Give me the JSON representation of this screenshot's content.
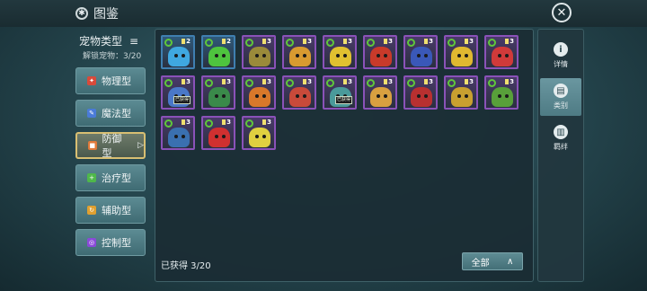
{
  "header": {
    "title": "图鉴",
    "gear_icon": "gear-icon",
    "close_icon": "close-icon"
  },
  "sidebar": {
    "heading": "宠物类型",
    "menu_glyph": "≡",
    "unlocked_text": "解锁宠物：3/20",
    "items": [
      {
        "label": "物理型",
        "icon_color": "#d84a3a",
        "glyph": "✦"
      },
      {
        "label": "魔法型",
        "icon_color": "#4a7bd8",
        "glyph": "✎"
      },
      {
        "label": "防御型",
        "icon_color": "#e07a3a",
        "glyph": "■",
        "active": true
      },
      {
        "label": "治疗型",
        "icon_color": "#4fb84a",
        "glyph": "+"
      },
      {
        "label": "辅助型",
        "icon_color": "#e0a030",
        "glyph": "↻"
      },
      {
        "label": "控制型",
        "icon_color": "#8a4ad8",
        "glyph": "◎"
      }
    ]
  },
  "pets": [
    {
      "level": "2",
      "color": "#3fa8e0",
      "basic": true
    },
    {
      "level": "2",
      "color": "#4ec43e",
      "basic": true
    },
    {
      "level": "3",
      "color": "#9a8a3a"
    },
    {
      "level": "3",
      "color": "#d89a30"
    },
    {
      "level": "3",
      "color": "#e0c030"
    },
    {
      "level": "3",
      "color": "#c83a2a"
    },
    {
      "level": "3",
      "color": "#3a58b8"
    },
    {
      "level": "3",
      "color": "#e0b830"
    },
    {
      "level": "3",
      "color": "#d03a3a"
    },
    {
      "level": "3",
      "color": "#4a78c8",
      "tag": "已获得"
    },
    {
      "level": "3",
      "color": "#3a8a4a"
    },
    {
      "level": "3",
      "color": "#d8782a"
    },
    {
      "level": "3",
      "color": "#c84a3a"
    },
    {
      "level": "3",
      "color": "#4a9a9a",
      "tag": "已获得"
    },
    {
      "level": "3",
      "color": "#d8a040"
    },
    {
      "level": "3",
      "color": "#b83030"
    },
    {
      "level": "3",
      "color": "#c8a030"
    },
    {
      "level": "3",
      "color": "#58a03a"
    },
    {
      "level": "3",
      "color": "#3a70b0"
    },
    {
      "level": "3",
      "color": "#d03030"
    },
    {
      "level": "3",
      "color": "#e0d040"
    }
  ],
  "footer": {
    "obtained": "已获得 3/20",
    "filter_label": "全部",
    "filter_arrow": "∧"
  },
  "right_tabs": [
    {
      "label": "详情",
      "glyph": "i"
    },
    {
      "label": "类别",
      "glyph": "▤",
      "active": true
    },
    {
      "label": "羁绊",
      "glyph": "▥"
    }
  ]
}
